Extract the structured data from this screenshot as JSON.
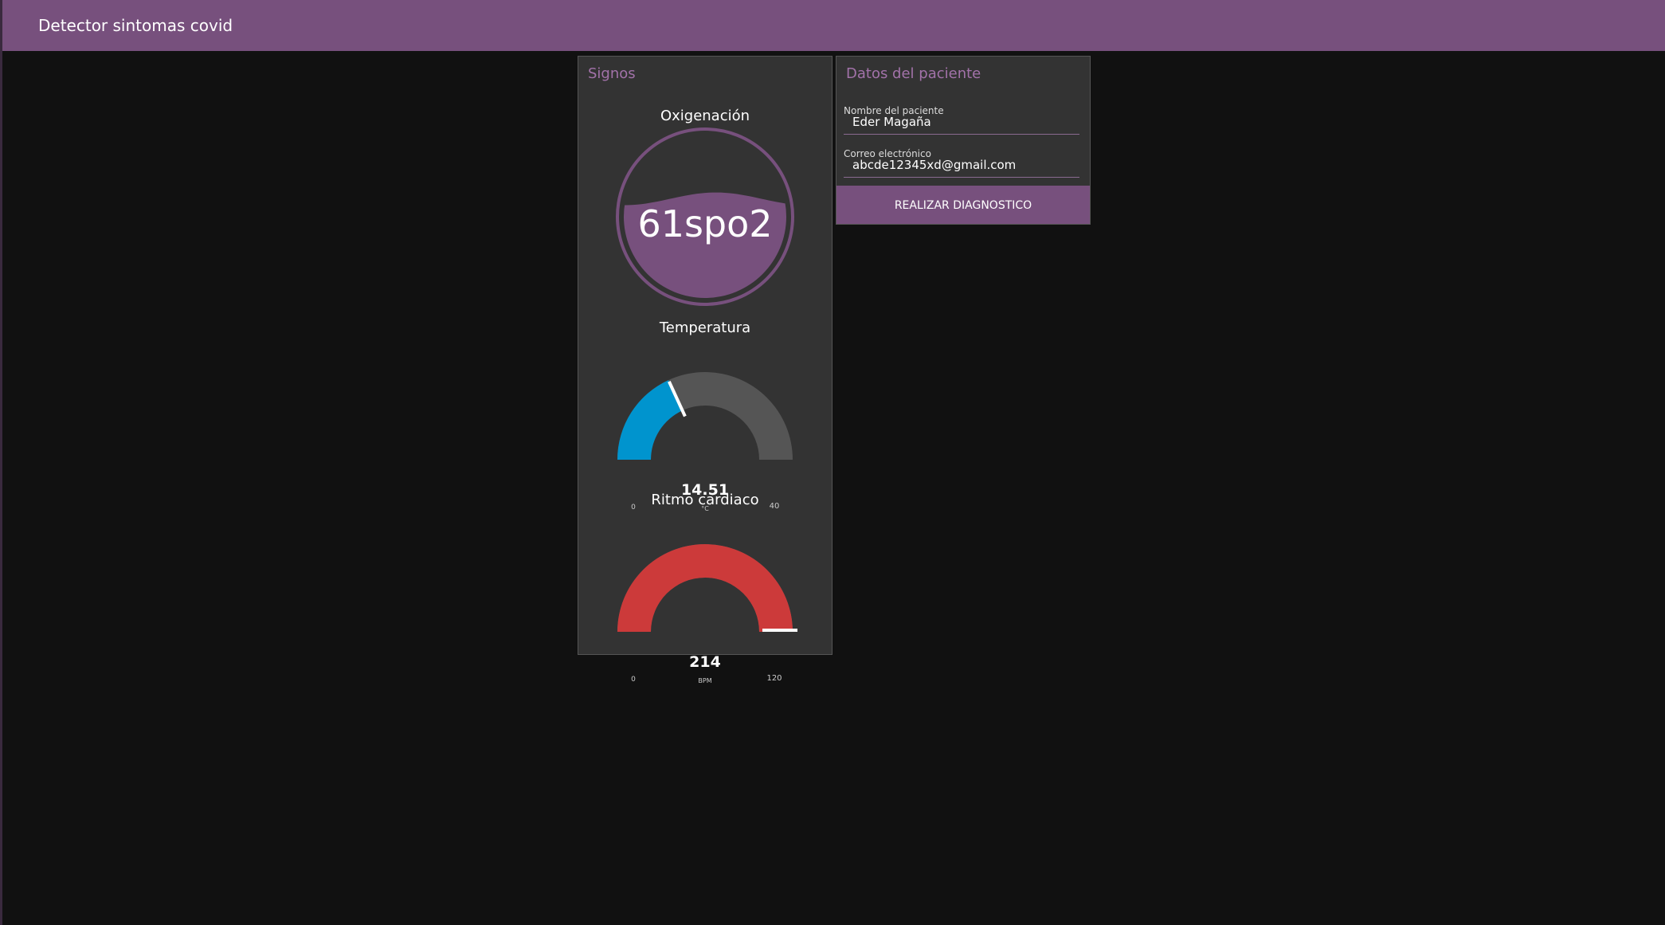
{
  "app": {
    "title": "Detector sintomas covid",
    "accent": "#77507d"
  },
  "signos": {
    "title": "Signos",
    "oxigenacion": {
      "label": "Oxigenación",
      "value": 61,
      "display": "61spo2",
      "fill_color": "#77507d"
    },
    "temperatura": {
      "label": "Temperatura",
      "value": 14.51,
      "display": "14.51",
      "unit": "°C",
      "min": 0,
      "max": 40,
      "min_label": "0",
      "max_label": "40",
      "color": "#0094ce"
    },
    "ritmo": {
      "label": "Ritmo cardiaco",
      "value": 214,
      "display": "214",
      "unit": "BPM",
      "min": 0,
      "max": 120,
      "min_label": "0",
      "max_label": "120",
      "color": "#cc3a3a"
    }
  },
  "datos": {
    "title": "Datos del paciente",
    "nombre": {
      "label": "Nombre del paciente",
      "value": "Eder Magaña"
    },
    "correo": {
      "label": "Correo electrónico",
      "value": "abcde12345xd@gmail.com"
    },
    "button_label": "REALIZAR DIAGNOSTICO"
  }
}
